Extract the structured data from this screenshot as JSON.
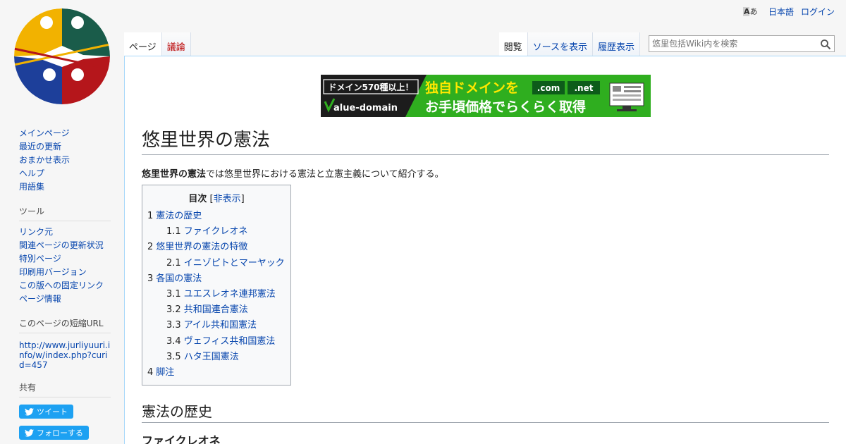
{
  "personal": {
    "language": "日本語",
    "login": "ログイン"
  },
  "tabs": {
    "page": "ページ",
    "talk": "議論",
    "read": "閲覧",
    "source": "ソースを表示",
    "history": "履歴表示"
  },
  "search": {
    "placeholder": "悠里包括Wiki内を検索"
  },
  "banner": {
    "badge": "ドメイン570種以上！",
    "headline": "独自ドメインを",
    "tld1": ".com",
    "tld2": ".net",
    "brand": "alue-domain",
    "tagline": "お手頃価格でらくらく取得"
  },
  "sidebar": {
    "nav": [
      "メインページ",
      "最近の更新",
      "おまかせ表示",
      "ヘルプ",
      "用語集"
    ],
    "tools_title": "ツール",
    "tools": [
      "リンク元",
      "関連ページの更新状況",
      "特別ページ",
      "印刷用バージョン",
      "この版への固定リンク",
      "ページ情報"
    ],
    "shorturl_title": "このページの短縮URL",
    "shorturl": "http://www.jurliyuuri.info/w/index.php?curid=457",
    "share_title": "共有",
    "tweet": "ツイート",
    "follow": "フォローする"
  },
  "article": {
    "title": "悠里世界の憲法",
    "intro_bold": "悠里世界の憲法",
    "intro_rest": "では悠里世界における憲法と立憲主義について紹介する。",
    "toc_title": "目次",
    "toc_hide": "非表示",
    "toc": [
      {
        "num": "1",
        "text": "憲法の歴史",
        "level": 1
      },
      {
        "num": "1.1",
        "text": "ファイクレオネ",
        "level": 2
      },
      {
        "num": "2",
        "text": "悠里世界の憲法の特徴",
        "level": 1
      },
      {
        "num": "2.1",
        "text": "イニゾピトとマーヤック",
        "level": 2
      },
      {
        "num": "3",
        "text": "各国の憲法",
        "level": 1
      },
      {
        "num": "3.1",
        "text": "ユエスレオネ連邦憲法",
        "level": 2
      },
      {
        "num": "3.2",
        "text": "共和国連合憲法",
        "level": 2
      },
      {
        "num": "3.3",
        "text": "アイル共和国憲法",
        "level": 2
      },
      {
        "num": "3.4",
        "text": "ヴェフィス共和国憲法",
        "level": 2
      },
      {
        "num": "3.5",
        "text": "ハタ王国憲法",
        "level": 2
      },
      {
        "num": "4",
        "text": "脚注",
        "level": 1
      }
    ],
    "h2": "憲法の歴史",
    "h3": "ファイクレオネ"
  }
}
